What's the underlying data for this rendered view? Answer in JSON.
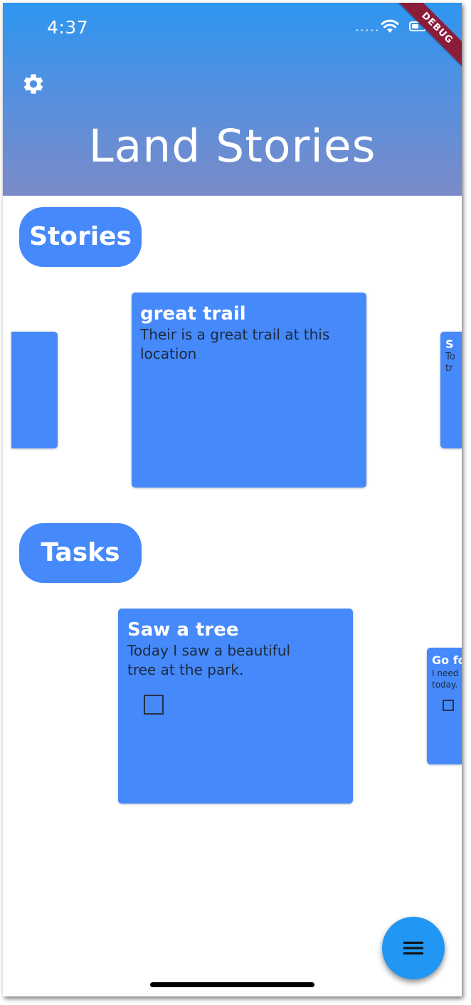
{
  "status_bar": {
    "time": "4:37",
    "signal_dots": "•••••",
    "debug_banner": "DEBUG"
  },
  "header": {
    "title": "Land Stories",
    "settings_icon": "gear-icon"
  },
  "stories": {
    "section_label": "Stories",
    "cards": [
      {
        "title": "great trail",
        "body": "Their is a great trail at this location"
      },
      {
        "title": "S",
        "body": "To tr"
      }
    ]
  },
  "tasks": {
    "section_label": "Tasks",
    "cards": [
      {
        "title": "Saw a tree",
        "body": "Today I saw a beautiful tree at the park.",
        "checked": false
      },
      {
        "title": "Go fo",
        "body": "I need today.",
        "checked": false
      }
    ]
  },
  "fab": {
    "icon": "menu-icon"
  },
  "colors": {
    "accent": "#4589fb",
    "fab": "#2196f3",
    "header_top": "#2e96f0",
    "header_bottom": "#7b8bc8"
  }
}
